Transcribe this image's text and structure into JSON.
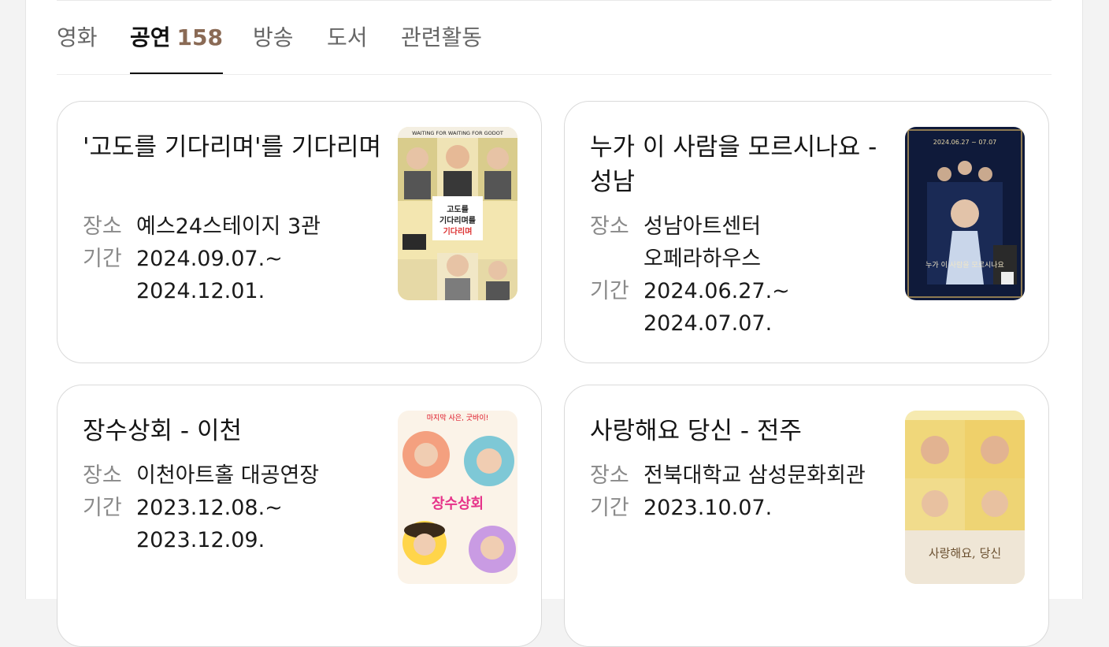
{
  "tabs": [
    {
      "label": "영화"
    },
    {
      "label": "공연",
      "count": "158",
      "active": true
    },
    {
      "label": "방송"
    },
    {
      "label": "도서"
    },
    {
      "label": "관련활동"
    }
  ],
  "cards": [
    {
      "title": "'고도를 기다리며'를 기다리며",
      "venue_label": "장소",
      "venue": "예스24스테이지 3관",
      "period_label": "기간",
      "period": "2024.09.07.~\n2024.12.01.",
      "poster": {
        "title_text": "고도를 기다리며를 기다리며",
        "banner": "WAITING FOR WAITING FOR GODOT"
      }
    },
    {
      "title": "누가 이 사람을 모르시나요 - 성남",
      "venue_label": "장소",
      "venue": "성남아트센터\n오페라하우스",
      "period_label": "기간",
      "period": "2024.06.27.~\n2024.07.07.",
      "poster": {
        "date_text": "2024.06.27 ~ 07.07",
        "title_text": "누가 이 사람을 모르시나요"
      }
    },
    {
      "title": "장수상회 - 이천",
      "venue_label": "장소",
      "venue": "이천아트홀 대공연장",
      "period_label": "기간",
      "period": "2023.12.08.~\n2023.12.09.",
      "poster": {
        "headline": "마지막 사은, 굿바이!",
        "title_text": "장수상회"
      }
    },
    {
      "title": "사랑해요 당신 - 전주",
      "venue_label": "장소",
      "venue": "전북대학교 삼성문화회관",
      "period_label": "기간",
      "period": "2023.10.07.",
      "poster": {
        "title_text": "사랑해요, 당신"
      }
    }
  ]
}
